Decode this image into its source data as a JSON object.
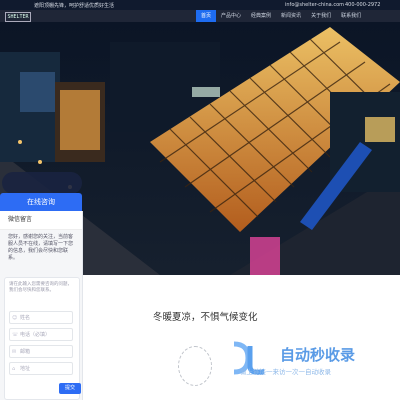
{
  "topbar": {
    "slogan": "遮阳顶棚先锋，呵护舒适优质好生活",
    "email": "info@shelter-china.com",
    "phone": "400-000-2972"
  },
  "nav": {
    "logo": "SHELTER",
    "items": [
      {
        "label": "首页",
        "active": true
      },
      {
        "label": "产品中心",
        "active": false
      },
      {
        "label": "经典案例",
        "active": false
      },
      {
        "label": "新闻资讯",
        "active": false
      },
      {
        "label": "关于我们",
        "active": false
      },
      {
        "label": "联系我们",
        "active": false
      }
    ],
    "active_color": "#1e6cf0"
  },
  "chat": {
    "tab_label": "在线咨询",
    "panel_title": "微信留言",
    "greeting": "您好，感谢您的关注，当前客服人员不在线，请填写一下您的信息，我们会尽快和您联系。",
    "form": {
      "message_placeholder": "请在此输入您需要咨询的问题，我们会尽快和您联系。",
      "fields": [
        {
          "icon": "user-icon",
          "placeholder": "姓名"
        },
        {
          "icon": "phone-icon",
          "placeholder": "电话（必填）"
        },
        {
          "icon": "mail-icon",
          "placeholder": "邮箱"
        },
        {
          "icon": "home-icon",
          "placeholder": "地址"
        }
      ],
      "submit_label": "提交"
    }
  },
  "main": {
    "tagline": "冬暖夏凉，不惧气候变化"
  },
  "watermark": {
    "title": "自动秒收录",
    "subtitle": "做上链接一来访一次一自动收录"
  },
  "colors": {
    "accent": "#2d6cf4",
    "dark": "#101a2e"
  }
}
